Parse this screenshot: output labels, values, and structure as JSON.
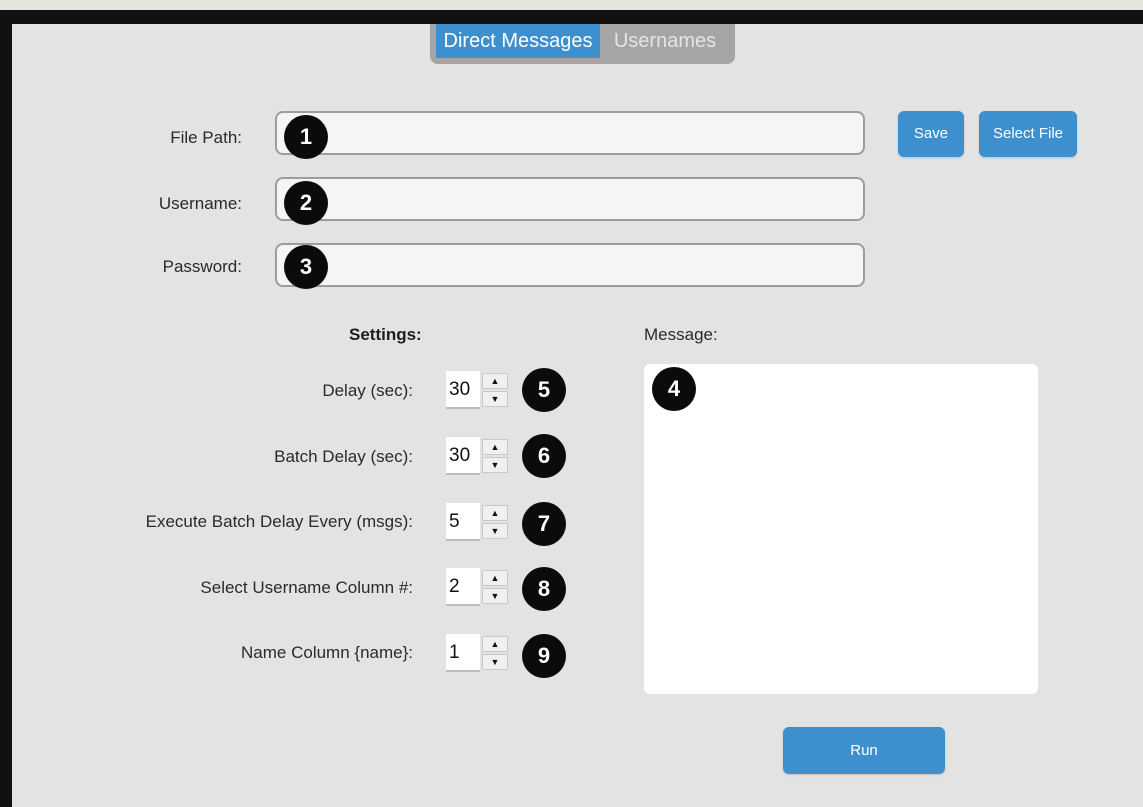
{
  "tabs": {
    "direct_messages": "Direct Messages",
    "usernames": "Usernames"
  },
  "form": {
    "file_path_label": "File Path:",
    "username_label": "Username:",
    "password_label": "Password:",
    "file_path_value": "",
    "username_value": "",
    "password_value": ""
  },
  "buttons": {
    "save": "Save",
    "select_file": "Select File",
    "run": "Run"
  },
  "settings": {
    "heading": "Settings:",
    "items": [
      {
        "label": "Delay (sec):",
        "value": "30",
        "badge": "5"
      },
      {
        "label": "Batch Delay (sec):",
        "value": "30",
        "badge": "6"
      },
      {
        "label": "Execute Batch Delay Every (msgs):",
        "value": "5",
        "badge": "7"
      },
      {
        "label": "Select Username Column #:",
        "value": "2",
        "badge": "8"
      },
      {
        "label": "Name Column {name}:",
        "value": "1",
        "badge": "9"
      }
    ]
  },
  "message": {
    "label": "Message:",
    "value": "",
    "badge": "4"
  },
  "badges": {
    "file_path": "1",
    "username": "2",
    "password": "3"
  },
  "spinner_icons": {
    "up": "▲",
    "down": "▼"
  },
  "colors": {
    "accent": "#3e8fce",
    "tab_inactive_bg": "#a5a5a5",
    "panel_bg": "#e3e3e3"
  }
}
